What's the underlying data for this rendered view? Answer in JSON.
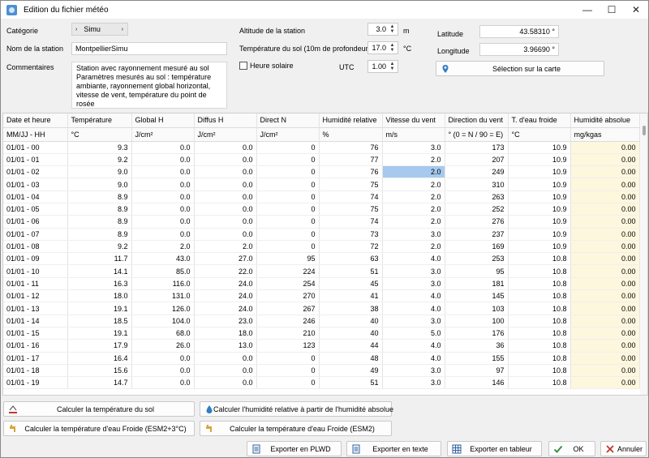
{
  "window": {
    "title": "Edition du fichier météo",
    "min": "—",
    "max": "☐",
    "close": "✕"
  },
  "left": {
    "categorie_label": "Catégorie",
    "categorie_value": "Simu",
    "station_label": "Nom de la station",
    "station_value": "MontpellierSimu",
    "comment_label": "Commentaires",
    "comment_value": "Station avec rayonnement mesuré au sol Paramètres mesurés au sol : température ambiante, rayonnement global horizontal, vitesse de vent, température du point de rosée"
  },
  "middle": {
    "altitude_label": "Altitude de la station",
    "altitude_value": "3.0",
    "altitude_unit": "m",
    "soil_label": "Température du sol (10m de profondeur)",
    "soil_value": "17.0",
    "soil_unit": "°C",
    "solar_label": "Heure solaire",
    "utc_label": "UTC",
    "utc_value": "1.00"
  },
  "right": {
    "lat_label": "Latitude",
    "lat_value": "43.58310 °",
    "lon_label": "Longitude",
    "lon_value": "3.96690 °",
    "map_button": "Sélection sur la carte"
  },
  "table": {
    "headers": [
      "Date et heure",
      "Température",
      "Global H",
      "Diffus H",
      "Direct N",
      "Humidité relative",
      "Vitesse du vent",
      "Direction du vent",
      "T. d'eau froide",
      "Humidité absolue"
    ],
    "units": [
      "MM/JJ - HH",
      "°C",
      "J/cm²",
      "J/cm²",
      "J/cm²",
      "%",
      "m/s",
      "° (0 = N / 90 = E)",
      "°C",
      "mg/kgas"
    ],
    "rows": [
      [
        "01/01 - 00",
        "9.3",
        "0.0",
        "0.0",
        "0",
        "76",
        "3.0",
        "173",
        "10.9",
        "0.00"
      ],
      [
        "01/01 - 01",
        "9.2",
        "0.0",
        "0.0",
        "0",
        "77",
        "2.0",
        "207",
        "10.9",
        "0.00"
      ],
      [
        "01/01 - 02",
        "9.0",
        "0.0",
        "0.0",
        "0",
        "76",
        "2.0",
        "249",
        "10.9",
        "0.00"
      ],
      [
        "01/01 - 03",
        "9.0",
        "0.0",
        "0.0",
        "0",
        "75",
        "2.0",
        "310",
        "10.9",
        "0.00"
      ],
      [
        "01/01 - 04",
        "8.9",
        "0.0",
        "0.0",
        "0",
        "74",
        "2.0",
        "263",
        "10.9",
        "0.00"
      ],
      [
        "01/01 - 05",
        "8.9",
        "0.0",
        "0.0",
        "0",
        "75",
        "2.0",
        "252",
        "10.9",
        "0.00"
      ],
      [
        "01/01 - 06",
        "8.9",
        "0.0",
        "0.0",
        "0",
        "74",
        "2.0",
        "276",
        "10.9",
        "0.00"
      ],
      [
        "01/01 - 07",
        "8.9",
        "0.0",
        "0.0",
        "0",
        "73",
        "3.0",
        "237",
        "10.9",
        "0.00"
      ],
      [
        "01/01 - 08",
        "9.2",
        "2.0",
        "2.0",
        "0",
        "72",
        "2.0",
        "169",
        "10.9",
        "0.00"
      ],
      [
        "01/01 - 09",
        "11.7",
        "43.0",
        "27.0",
        "95",
        "63",
        "4.0",
        "253",
        "10.8",
        "0.00"
      ],
      [
        "01/01 - 10",
        "14.1",
        "85.0",
        "22.0",
        "224",
        "51",
        "3.0",
        "95",
        "10.8",
        "0.00"
      ],
      [
        "01/01 - 11",
        "16.3",
        "116.0",
        "24.0",
        "254",
        "45",
        "3.0",
        "181",
        "10.8",
        "0.00"
      ],
      [
        "01/01 - 12",
        "18.0",
        "131.0",
        "24.0",
        "270",
        "41",
        "4.0",
        "145",
        "10.8",
        "0.00"
      ],
      [
        "01/01 - 13",
        "19.1",
        "126.0",
        "24.0",
        "267",
        "38",
        "4.0",
        "103",
        "10.8",
        "0.00"
      ],
      [
        "01/01 - 14",
        "18.5",
        "104.0",
        "23.0",
        "246",
        "40",
        "3.0",
        "100",
        "10.8",
        "0.00"
      ],
      [
        "01/01 - 15",
        "19.1",
        "68.0",
        "18.0",
        "210",
        "40",
        "5.0",
        "176",
        "10.8",
        "0.00"
      ],
      [
        "01/01 - 16",
        "17.9",
        "26.0",
        "13.0",
        "123",
        "44",
        "4.0",
        "36",
        "10.8",
        "0.00"
      ],
      [
        "01/01 - 17",
        "16.4",
        "0.0",
        "0.0",
        "0",
        "48",
        "4.0",
        "155",
        "10.8",
        "0.00"
      ],
      [
        "01/01 - 18",
        "15.6",
        "0.0",
        "0.0",
        "0",
        "49",
        "3.0",
        "97",
        "10.8",
        "0.00"
      ],
      [
        "01/01 - 19",
        "14.7",
        "0.0",
        "0.0",
        "0",
        "51",
        "3.0",
        "146",
        "10.8",
        "0.00"
      ]
    ]
  },
  "buttons": {
    "calc_soil": "Calculer la température du sol",
    "calc_humidity": "Calculer l'humidité relative à partir de l'humidité absolue",
    "calc_water_esm2_3": "Calculer la température d'eau Froide (ESM2+3°C)",
    "calc_water_esm2": "Calculer la température d'eau Froide (ESM2)",
    "export_plwd": "Exporter en PLWD",
    "export_text": "Exporter en texte",
    "export_table": "Exporter en tableur",
    "ok": "OK",
    "cancel": "Annuler"
  },
  "colors": {
    "selected_cell": "#a7c9ef",
    "absolute_humidity_column": "#fdf7dd",
    "ok_check": "#2e8b3d",
    "cancel_x": "#c0392b"
  }
}
